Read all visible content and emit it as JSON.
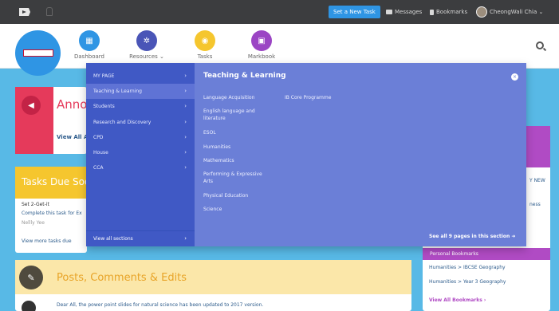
{
  "topbar": {
    "set_task": "Set a New Task",
    "messages": "Messages",
    "bookmarks": "Bookmarks",
    "user": "CheongWali Chia ⌄"
  },
  "nav": {
    "items": [
      {
        "label": "Dashboard",
        "icon": "dashboard-icon",
        "color": "#2f95e4"
      },
      {
        "label": "Resources ⌄",
        "icon": "resources-icon",
        "color": "#4a55b7"
      },
      {
        "label": "Tasks",
        "icon": "tasks-icon",
        "color": "#f5c62e"
      },
      {
        "label": "Markbook",
        "icon": "markbook-icon",
        "color": "#9b45c4"
      }
    ]
  },
  "menu": {
    "left_items": [
      "MY PAGE",
      "Teaching & Learning",
      "Students",
      "Research and Discovery",
      "CPD",
      "House",
      "CCA"
    ],
    "active_index": 1,
    "view_all": "View all sections",
    "title": "Teaching & Learning",
    "col1": [
      "Language Acquisition",
      "English language and literature",
      "ESOL",
      "Humanities",
      "Mathematics",
      "Performing & Expressive Arts",
      "Physical Education",
      "Science"
    ],
    "col2": [
      "IB Core Programme"
    ],
    "see_all": "See all 9 pages in this section"
  },
  "announcements": {
    "title": "Anno",
    "view_all": "View All A"
  },
  "tasks": {
    "title": "Tasks Due Soo",
    "item_title": "Set 2-Get-it",
    "item_link": "Complete this task for Ex",
    "item_meta": "Nellly Yee",
    "view_more": "View more tasks due"
  },
  "posts": {
    "title": "Posts, Comments & Edits",
    "snippet": "Dear All, the power point slides for natural science has been updated to 2017 version."
  },
  "bookmarks": {
    "peek1": "Y NEW",
    "peek2": "ness",
    "personal": "Personal Bookmarks",
    "links": [
      "Humanities > IBCSE Geography",
      "Humanities > Year 3 Geography"
    ],
    "view_all": "View All Bookmarks ›"
  },
  "colors": {
    "accent_blue": "#2f95e4",
    "menu_bg": "#6b7fd7",
    "menu_left": "#4059c5",
    "announce_red": "#e53a5b",
    "tasks_yellow": "#f5c62e",
    "bookmark_purple": "#b04bc4"
  }
}
